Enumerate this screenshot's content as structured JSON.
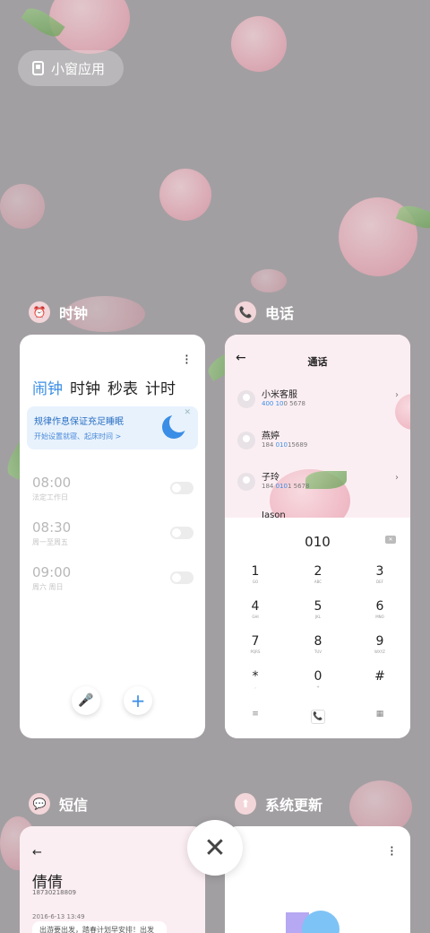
{
  "floating_apps": {
    "label": "小窗应用"
  },
  "cards": {
    "clock": {
      "title": "时钟",
      "tabs": [
        "闹钟",
        "时钟",
        "秒表",
        "计时"
      ],
      "promo": {
        "title": "规律作息保证充足睡眠",
        "subtitle": "开始设置就寝、起床时间 >"
      },
      "alarms": [
        {
          "time": "08:00",
          "days": "法定工作日",
          "enabled": false
        },
        {
          "time": "08:30",
          "days": "周一至周五",
          "enabled": false
        },
        {
          "time": "09:00",
          "days": "周六 周日",
          "enabled": false
        }
      ]
    },
    "phone": {
      "title": "电话",
      "header": "通话",
      "contacts": [
        {
          "name": "小米客服",
          "number_hl": "400 10",
          "number_rest": "0 5678"
        },
        {
          "name": "燕婷",
          "number_pre": "184 ",
          "number_hl": "010",
          "number_rest": "15689"
        },
        {
          "name": "子玲",
          "number_pre": "184 ",
          "number_hl": "010",
          "number_rest": "1 5678"
        },
        {
          "name": "Jason"
        }
      ],
      "dial_input": "010",
      "keys": [
        {
          "num": "1",
          "sub": "GO"
        },
        {
          "num": "2",
          "sub": "ABC"
        },
        {
          "num": "3",
          "sub": "DEF"
        },
        {
          "num": "4",
          "sub": "GHI"
        },
        {
          "num": "5",
          "sub": "JKL"
        },
        {
          "num": "6",
          "sub": "MNO"
        },
        {
          "num": "7",
          "sub": "PQRS"
        },
        {
          "num": "8",
          "sub": "TUV"
        },
        {
          "num": "9",
          "sub": "WXYZ"
        },
        {
          "num": "*",
          "sub": ","
        },
        {
          "num": "0",
          "sub": "+"
        },
        {
          "num": "#",
          "sub": ""
        }
      ]
    },
    "sms": {
      "title": "短信",
      "contact_name": "倩倩",
      "contact_number": "18730218809",
      "timestamp": "2016-6-13 13:49",
      "preview": "出游要出发，踏春计划早安排！出发"
    },
    "update": {
      "title": "系统更新"
    }
  },
  "colors": {
    "accent": "#3a8ee6",
    "background": "#a29fa2"
  }
}
